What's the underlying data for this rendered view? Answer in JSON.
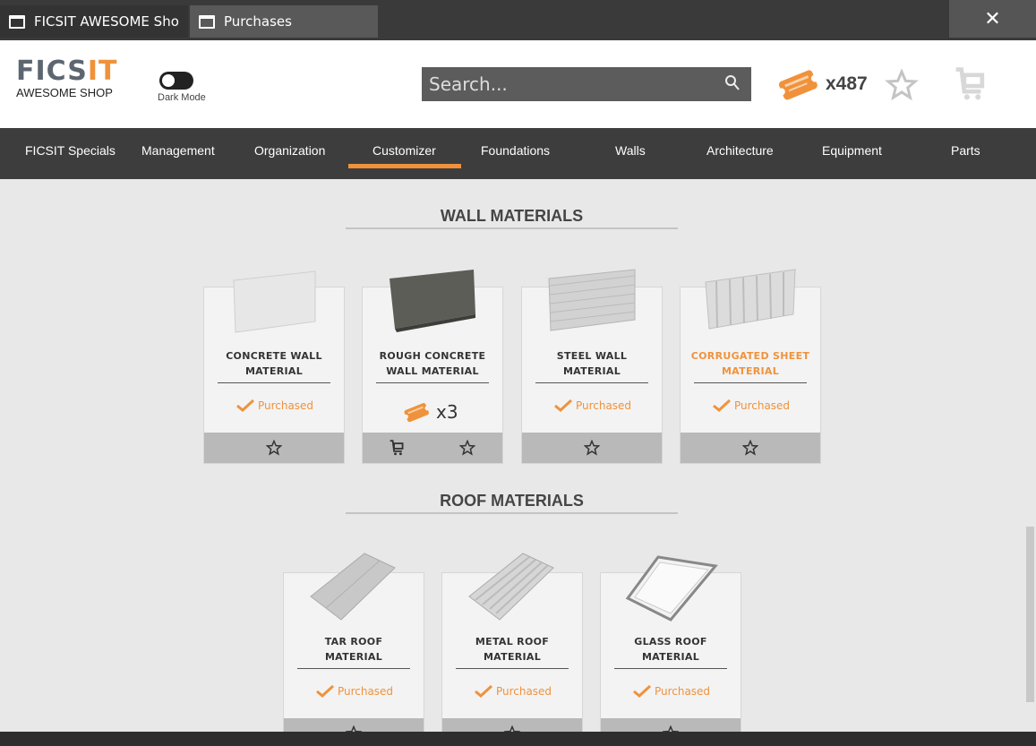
{
  "window": {
    "tabs": [
      {
        "label": "FICSIT AWESOME Sho"
      },
      {
        "label": "Purchases"
      }
    ],
    "close_glyph": "✕"
  },
  "header": {
    "logo_main_a": "FICS",
    "logo_main_b": "IT",
    "logo_sub": "AWESOME SHOP",
    "dark_mode_label": "Dark Mode",
    "search_placeholder": "Search...",
    "coupon_count": "x487",
    "accent_color": "#f0923b"
  },
  "nav": {
    "items": [
      {
        "label": "FICSIT Specials"
      },
      {
        "label": "Management"
      },
      {
        "label": "Organization"
      },
      {
        "label": "Customizer"
      },
      {
        "label": "Foundations"
      },
      {
        "label": "Walls"
      },
      {
        "label": "Architecture"
      },
      {
        "label": "Equipment"
      },
      {
        "label": "Parts"
      }
    ],
    "active": "Customizer"
  },
  "sections": [
    {
      "title": "WALL MATERIALS",
      "cards": [
        {
          "name_1": "CONCRETE WALL",
          "name_2": "MATERIAL",
          "status": "Purchased"
        },
        {
          "name_1": "ROUGH CONCRETE",
          "name_2": "WALL MATERIAL",
          "price": "x3"
        },
        {
          "name_1": "STEEL WALL",
          "name_2": "MATERIAL",
          "status": "Purchased"
        },
        {
          "name_1": "CORRUGATED SHEET",
          "name_2": "MATERIAL",
          "status": "Purchased"
        }
      ]
    },
    {
      "title": "ROOF MATERIALS",
      "cards": [
        {
          "name_1": "TAR ROOF",
          "name_2": "MATERIAL",
          "status": "Purchased"
        },
        {
          "name_1": "METAL ROOF",
          "name_2": "MATERIAL",
          "status": "Purchased"
        },
        {
          "name_1": "GLASS ROOF",
          "name_2": "MATERIAL",
          "status": "Purchased"
        }
      ]
    }
  ]
}
